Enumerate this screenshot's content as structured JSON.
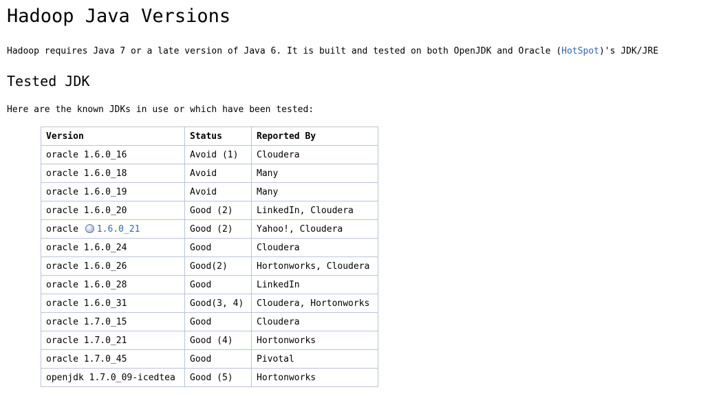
{
  "title": "Hadoop Java Versions",
  "intro": {
    "before": "Hadoop requires Java 7 or a late version of Java 6. It is built and tested on both OpenJDK and Oracle (",
    "link": "HotSpot",
    "after": ")'s JDK/JRE"
  },
  "section_title": "Tested JDK",
  "lead": "Here are the known JDKs in use or which have been tested:",
  "table": {
    "headers": [
      "Version",
      "Status",
      "Reported By"
    ],
    "rows": [
      {
        "version": "oracle 1.6.0_16",
        "status": "Avoid (1)",
        "reported": "Cloudera"
      },
      {
        "version": "oracle 1.6.0_18",
        "status": "Avoid",
        "reported": "Many"
      },
      {
        "version": "oracle 1.6.0_19",
        "status": "Avoid",
        "reported": "Many"
      },
      {
        "version": "oracle 1.6.0_20",
        "status": "Good (2)",
        "reported": "LinkedIn, Cloudera"
      },
      {
        "version_prefix": "oracle",
        "version_link": "1.6.0_21",
        "icon": "globe-icon",
        "status": "Good (2)",
        "reported": "Yahoo!, Cloudera"
      },
      {
        "version": "oracle 1.6.0_24",
        "status": "Good",
        "reported": "Cloudera"
      },
      {
        "version": "oracle 1.6.0_26",
        "status": "Good(2)",
        "reported": "Hortonworks, Cloudera"
      },
      {
        "version": "oracle 1.6.0_28",
        "status": "Good",
        "reported": "LinkedIn"
      },
      {
        "version": "oracle 1.6.0_31",
        "status": "Good(3, 4)",
        "reported": "Cloudera, Hortonworks"
      },
      {
        "version": "oracle 1.7.0_15",
        "status": "Good",
        "reported": "Cloudera"
      },
      {
        "version": "oracle 1.7.0_21",
        "status": "Good (4)",
        "reported": "Hortonworks"
      },
      {
        "version": "oracle 1.7.0_45",
        "status": "Good",
        "reported": "Pivotal"
      },
      {
        "version": "openjdk 1.7.0_09-icedtea",
        "status": "Good (5)",
        "reported": "Hortonworks"
      }
    ]
  },
  "colors": {
    "link": "#3366aa",
    "table_border": "#b8c4d8"
  }
}
